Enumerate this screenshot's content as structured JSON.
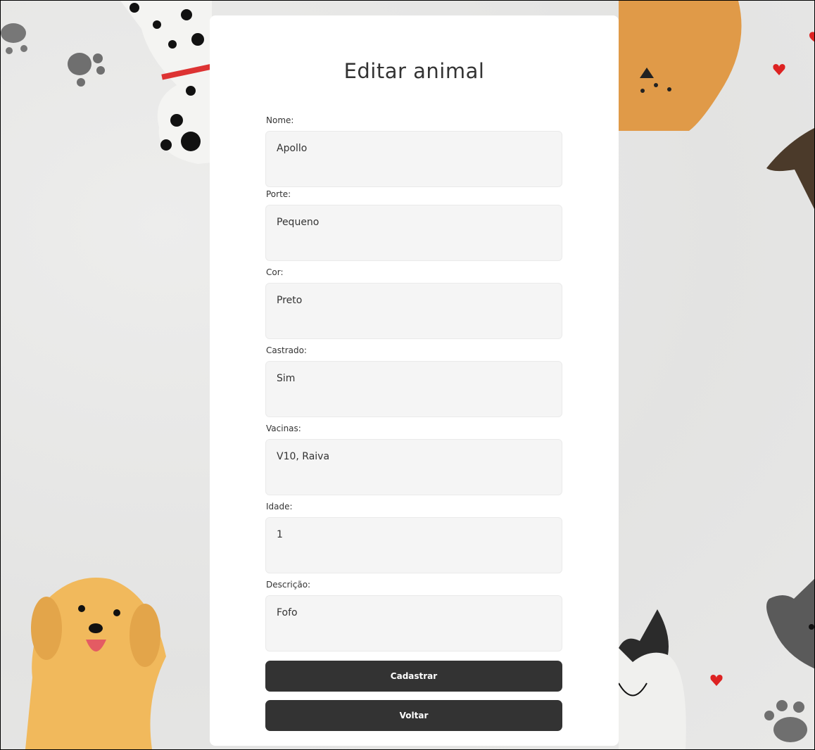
{
  "form": {
    "title": "Editar animal",
    "fields": [
      {
        "label": "Nome:",
        "value": "Apollo"
      },
      {
        "label": "Porte:",
        "value": "Pequeno"
      },
      {
        "label": "Cor:",
        "value": "Preto"
      },
      {
        "label": "Castrado:",
        "value": "Sim"
      },
      {
        "label": "Vacinas:",
        "value": "V10, Raiva"
      },
      {
        "label": "Idade:",
        "value": "1"
      },
      {
        "label": "Descrição:",
        "value": "Fofo"
      }
    ],
    "submit_label": "Cadastrar",
    "back_label": "Voltar"
  },
  "colors": {
    "button": "#333333",
    "field_bg": "#f5f5f5",
    "card": "#ffffff"
  }
}
